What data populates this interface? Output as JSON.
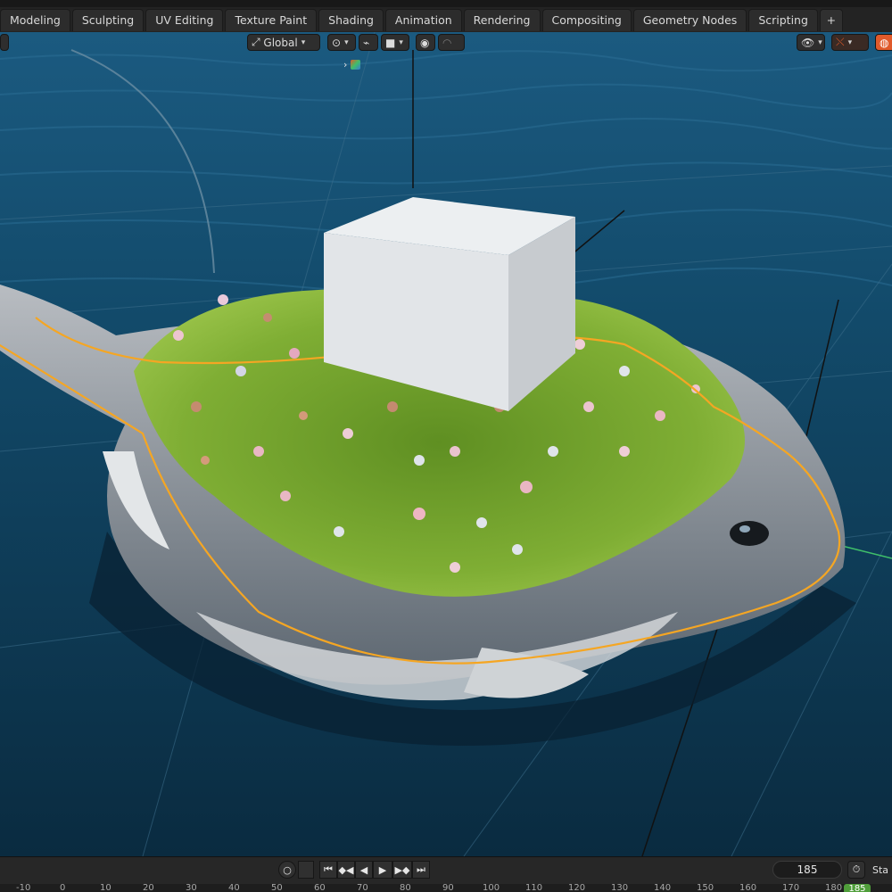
{
  "workspace_tabs": [
    {
      "label": "Modeling"
    },
    {
      "label": "Sculpting"
    },
    {
      "label": "UV Editing"
    },
    {
      "label": "Texture Paint"
    },
    {
      "label": "Shading"
    },
    {
      "label": "Animation"
    },
    {
      "label": "Rendering"
    },
    {
      "label": "Compositing"
    },
    {
      "label": "Geometry Nodes"
    },
    {
      "label": "Scripting"
    }
  ],
  "add_workspace_label": "+",
  "viewport_header": {
    "transform_orientation": "Global",
    "icons": [
      "transform-orientation-icon",
      "pivot-point-icon",
      "snap-icon",
      "snap-target-icon",
      "proportional-editing-icon",
      "proportional-falloff-icon",
      "visibility-icon",
      "gizmo-icon",
      "overlay-icon"
    ]
  },
  "colors": {
    "water": "#0f3b57",
    "grass": "#7fae34",
    "selection_outline": "#f5a623",
    "current_frame": "#4f9e3a",
    "overlay_orange": "#e05a2b"
  },
  "timeline": {
    "current_frame": "185",
    "start_label": "Sta",
    "ruler_ticks": [
      "-10",
      "0",
      "10",
      "20",
      "30",
      "40",
      "50",
      "60",
      "70",
      "80",
      "90",
      "100",
      "110",
      "120",
      "130",
      "140",
      "150",
      "160",
      "170",
      "180"
    ],
    "current_frame_badge": "185",
    "playback_icons": [
      "record-icon",
      "jump-start-icon",
      "prev-keyframe-icon",
      "play-reverse-icon",
      "play-icon",
      "next-keyframe-icon",
      "jump-end-icon"
    ]
  }
}
